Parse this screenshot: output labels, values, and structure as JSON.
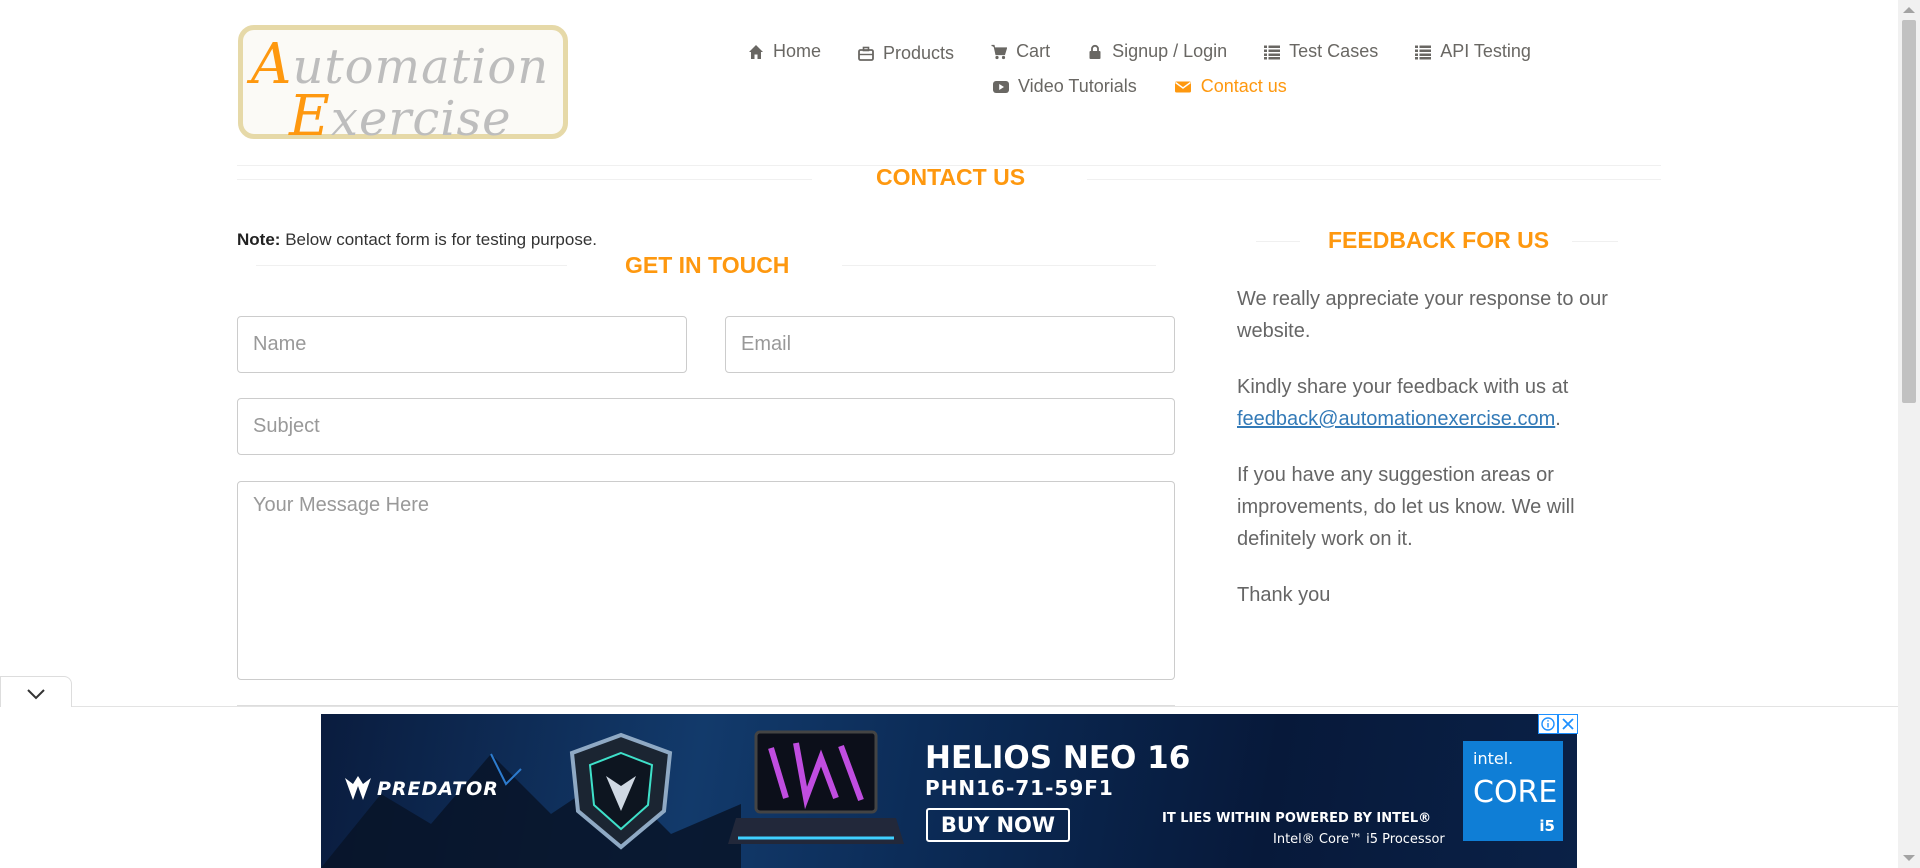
{
  "logo": {
    "line1_cap": "A",
    "line1_rest": "utomation",
    "line2_cap": "E",
    "line2_rest": "xercise"
  },
  "nav": {
    "row1": [
      {
        "label": "Home",
        "icon": "home-icon"
      },
      {
        "label": "Products",
        "icon": "briefcase-icon"
      },
      {
        "label": "Cart",
        "icon": "cart-icon"
      },
      {
        "label": "Signup / Login",
        "icon": "lock-icon"
      },
      {
        "label": "Test Cases",
        "icon": "list-icon"
      },
      {
        "label": "API Testing",
        "icon": "list-icon"
      }
    ],
    "row2": [
      {
        "label": "Video Tutorials",
        "icon": "youtube-icon"
      },
      {
        "label": "Contact us",
        "icon": "envelope-icon",
        "active": true
      }
    ]
  },
  "page": {
    "title": "Contact Us",
    "note_label": "Note:",
    "note_text": "Below contact form is for testing purpose."
  },
  "form": {
    "title": "Get In Touch",
    "name_placeholder": "Name",
    "email_placeholder": "Email",
    "subject_placeholder": "Subject",
    "message_placeholder": "Your Message Here"
  },
  "feedback": {
    "title": "Feedback For Us",
    "p1": "We really appreciate your response to our website.",
    "p2_text": "Kindly share your feedback with us at",
    "p2_email": "feedback@automationexercise.com",
    "p2_end": ".",
    "p3": "If you have any suggestion areas or improvements, do let us know. We will definitely work on it.",
    "p4": "Thank you"
  },
  "ad": {
    "brand": "PREDATOR",
    "model": "HELIOS NEO 16",
    "sku": "PHN16-71-59F1",
    "cta": "BUY NOW",
    "tagline": "IT LIES WITHIN POWERED BY INTEL®",
    "processor": "Intel® Core™ i5 Processor",
    "chip_brand": "intel.",
    "chip_line": "CORE",
    "chip_tier": "i5"
  },
  "colors": {
    "accent": "#FE980F",
    "link": "#337AB7",
    "text": "#696763"
  }
}
